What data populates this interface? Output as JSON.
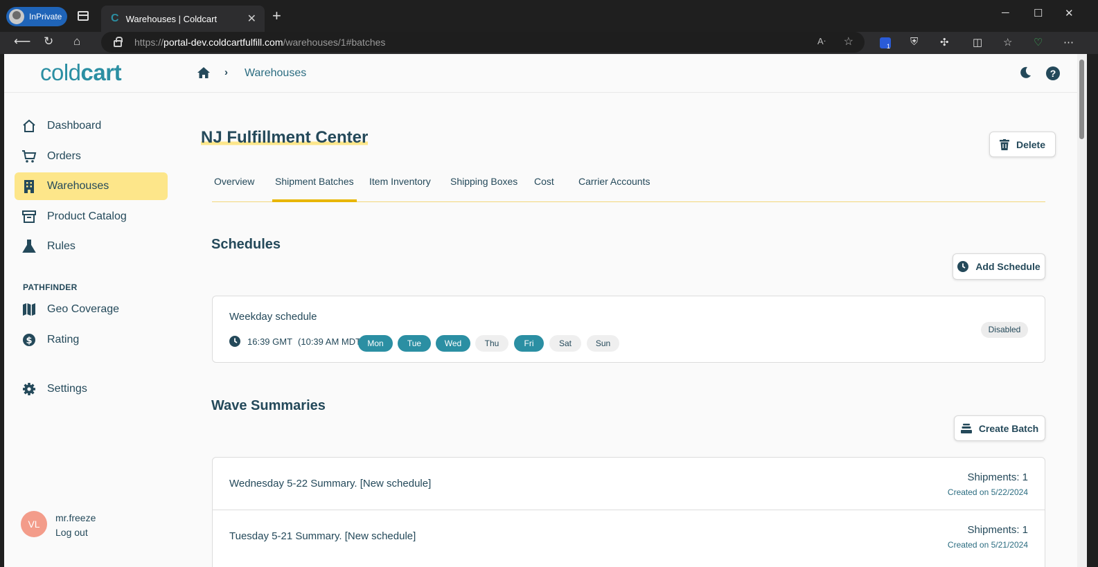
{
  "browser": {
    "inprivate_label": "InPrivate",
    "tab_title": "Warehouses | Coldcart",
    "url_prefix": "https://",
    "url_domain": "portal-dev.coldcartfulfill.com",
    "url_path": "/warehouses/1#batches",
    "extension_badge": "1"
  },
  "header": {
    "logo_light": "cold",
    "logo_bold": "cart",
    "breadcrumb": "Warehouses"
  },
  "sidebar": {
    "items": [
      {
        "label": "Dashboard",
        "icon": "home-icon"
      },
      {
        "label": "Orders",
        "icon": "cart-icon"
      },
      {
        "label": "Warehouses",
        "icon": "building-icon"
      },
      {
        "label": "Product Catalog",
        "icon": "archive-icon"
      },
      {
        "label": "Rules",
        "icon": "flask-icon"
      }
    ],
    "section_label": "PATHFINDER",
    "pathfinder_items": [
      {
        "label": "Geo Coverage",
        "icon": "map-icon"
      },
      {
        "label": "Rating",
        "icon": "dollar-icon"
      }
    ],
    "settings_label": "Settings",
    "user": {
      "initials": "VL",
      "name": "mr.freeze",
      "logout": "Log out"
    }
  },
  "main": {
    "title": "NJ Fulfillment Center",
    "delete_label": "Delete",
    "tabs": [
      "Overview",
      "Shipment Batches",
      "Item Inventory",
      "Shipping Boxes",
      "Cost",
      "Carrier Accounts"
    ],
    "active_tab": "Shipment Batches",
    "schedules_heading": "Schedules",
    "add_schedule_label": "Add Schedule",
    "schedule": {
      "name": "Weekday schedule",
      "time": "16:39 GMT",
      "local_time": "(10:39 AM MDT)",
      "days": [
        {
          "label": "Mon",
          "active": true
        },
        {
          "label": "Tue",
          "active": true
        },
        {
          "label": "Wed",
          "active": true
        },
        {
          "label": "Thu",
          "active": false
        },
        {
          "label": "Fri",
          "active": true
        },
        {
          "label": "Sat",
          "active": false
        },
        {
          "label": "Sun",
          "active": false
        }
      ],
      "status": "Disabled"
    },
    "wave_heading": "Wave Summaries",
    "create_batch_label": "Create Batch",
    "waves": [
      {
        "label": "Wednesday 5-22 Summary. [New schedule]",
        "shipments": "Shipments: 1",
        "created": "Created on 5/22/2024"
      },
      {
        "label": "Tuesday 5-21 Summary. [New schedule]",
        "shipments": "Shipments: 1",
        "created": "Created on 5/21/2024"
      }
    ]
  },
  "colors": {
    "brand_teal": "#2b8fa3",
    "navy_text": "#24495a",
    "active_highlight": "#fde68a",
    "tab_underline": "#e8b600"
  }
}
